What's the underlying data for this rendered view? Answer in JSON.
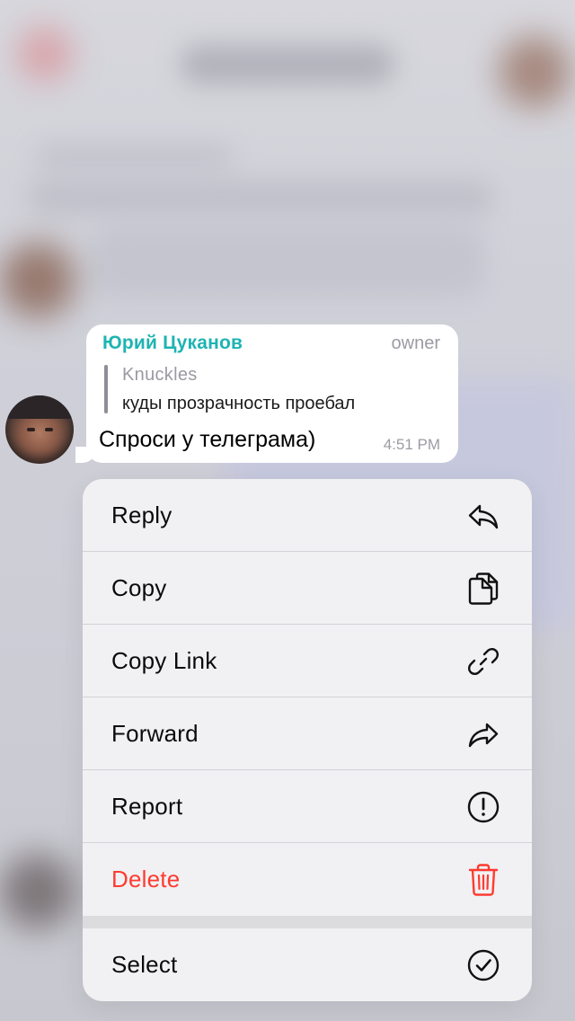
{
  "message": {
    "sender": "Юрий Цуканов",
    "role": "owner",
    "reply": {
      "author": "Knuckles",
      "text": "куды прозрачность проебал"
    },
    "text": "Спроси у телеграма)",
    "time": "4:51 PM"
  },
  "menu": {
    "items": [
      {
        "label": "Reply",
        "icon": "reply-icon"
      },
      {
        "label": "Copy",
        "icon": "copy-icon"
      },
      {
        "label": "Copy Link",
        "icon": "link-icon"
      },
      {
        "label": "Forward",
        "icon": "forward-icon"
      },
      {
        "label": "Report",
        "icon": "report-icon"
      },
      {
        "label": "Delete",
        "icon": "trash-icon",
        "color": "#ff3b30"
      },
      {
        "label": "Select",
        "icon": "checkmark-circle-icon"
      }
    ]
  },
  "colors": {
    "sender_name": "#1fb3b3",
    "destructive": "#ff3b30",
    "menu_background": "#f1f1f3"
  }
}
